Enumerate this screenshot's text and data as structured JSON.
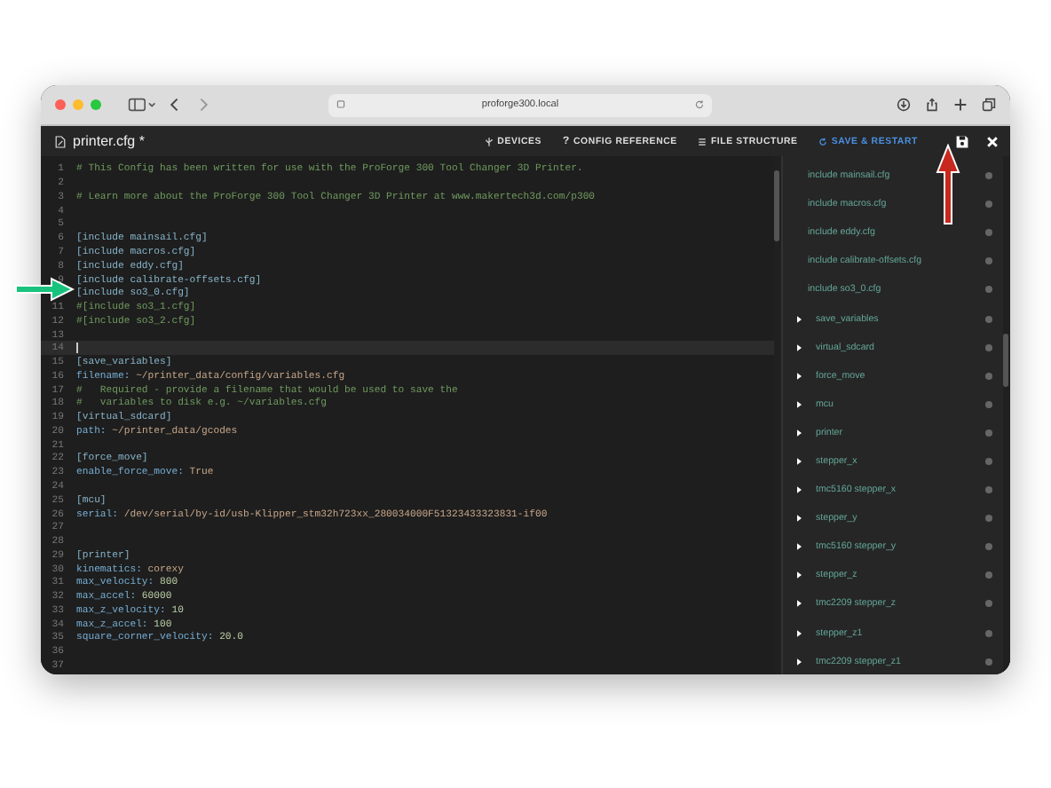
{
  "browser": {
    "url": "proforge300.local"
  },
  "toolbar": {
    "file_title": "printer.cfg *",
    "actions": [
      {
        "kind": "devices",
        "label": "DEVICES"
      },
      {
        "kind": "reference",
        "icon": "?",
        "label": "CONFIG REFERENCE"
      },
      {
        "kind": "structure",
        "label": "FILE STRUCTURE"
      },
      {
        "kind": "save_restart",
        "label": "SAVE & RESTART"
      }
    ]
  },
  "editor": {
    "lines": [
      {
        "n": "1",
        "current": false,
        "parts": [
          {
            "kind": "comment",
            "text": "# This Config has been written for use with the ProForge 300 Tool Changer 3D Printer."
          }
        ]
      },
      {
        "n": "2",
        "current": false
      },
      {
        "n": "3",
        "current": false,
        "parts": [
          {
            "kind": "comment",
            "text": "# Learn more about the ProForge 300 Tool Changer 3D Printer at www.makertech3d.com/p300"
          }
        ]
      },
      {
        "n": "4",
        "current": false
      },
      {
        "n": "5",
        "current": false
      },
      {
        "n": "6",
        "current": false,
        "parts": [
          {
            "kind": "section",
            "text": "[include mainsail.cfg]"
          }
        ]
      },
      {
        "n": "7",
        "current": false,
        "parts": [
          {
            "kind": "section",
            "text": "[include macros.cfg]"
          }
        ]
      },
      {
        "n": "8",
        "current": false,
        "parts": [
          {
            "kind": "section",
            "text": "[include eddy.cfg]"
          }
        ]
      },
      {
        "n": "9",
        "current": false,
        "parts": [
          {
            "kind": "section",
            "text": "[include calibrate-offsets.cfg]"
          }
        ]
      },
      {
        "current": false,
        "parts": [
          {
            "kind": "section",
            "text": "[include so3_0.cfg]"
          }
        ]
      },
      {
        "n": "11",
        "current": false,
        "parts": [
          {
            "kind": "comment",
            "text": "#[include so3_1.cfg]"
          }
        ]
      },
      {
        "n": "12",
        "current": false,
        "parts": [
          {
            "kind": "comment",
            "text": "#[include so3_2.cfg]"
          }
        ]
      },
      {
        "n": "13",
        "current": false
      },
      {
        "n": "14",
        "current": true
      },
      {
        "n": "15",
        "current": false,
        "parts": [
          {
            "kind": "section",
            "text": "[save_variables]"
          }
        ]
      },
      {
        "n": "16",
        "current": false,
        "parts": [
          {
            "kind": "key",
            "text": "filename:"
          },
          {
            "kind": "string",
            "text": " ~/printer_data/config/variables.cfg"
          }
        ]
      },
      {
        "n": "17",
        "current": false,
        "parts": [
          {
            "kind": "comment",
            "text": "#   Required - provide a filename that would be used to save the"
          }
        ]
      },
      {
        "n": "18",
        "current": false,
        "parts": [
          {
            "kind": "comment",
            "text": "#   variables to disk e.g. ~/variables.cfg"
          }
        ]
      },
      {
        "n": "19",
        "current": false,
        "parts": [
          {
            "kind": "section",
            "text": "[virtual_sdcard]"
          }
        ]
      },
      {
        "n": "20",
        "current": false,
        "parts": [
          {
            "kind": "key",
            "text": "path:"
          },
          {
            "kind": "string",
            "text": " ~/printer_data/gcodes"
          }
        ]
      },
      {
        "n": "21",
        "current": false
      },
      {
        "n": "22",
        "current": false,
        "parts": [
          {
            "kind": "section",
            "text": "[force_move]"
          }
        ]
      },
      {
        "n": "23",
        "current": false,
        "parts": [
          {
            "kind": "key",
            "text": "enable_force_move:"
          },
          {
            "kind": "string",
            "text": " True"
          }
        ]
      },
      {
        "n": "24",
        "current": false
      },
      {
        "n": "25",
        "current": false,
        "parts": [
          {
            "kind": "section",
            "text": "[mcu]"
          }
        ]
      },
      {
        "n": "26",
        "current": false,
        "parts": [
          {
            "kind": "key",
            "text": "serial:"
          },
          {
            "kind": "string",
            "text": " /dev/serial/by-id/usb-Klipper_stm32h723xx_280034000F51323433323831-if00"
          }
        ]
      },
      {
        "n": "27",
        "current": false
      },
      {
        "n": "28",
        "current": false
      },
      {
        "n": "29",
        "current": false,
        "parts": [
          {
            "kind": "section",
            "text": "[printer]"
          }
        ]
      },
      {
        "n": "30",
        "current": false,
        "parts": [
          {
            "kind": "key",
            "text": "kinematics:"
          },
          {
            "kind": "string",
            "text": " corexy"
          }
        ]
      },
      {
        "n": "31",
        "current": false,
        "parts": [
          {
            "kind": "key",
            "text": "max_velocity:"
          },
          {
            "kind": "number",
            "text": " 800"
          }
        ]
      },
      {
        "n": "32",
        "current": false,
        "parts": [
          {
            "kind": "key",
            "text": "max_accel:"
          },
          {
            "kind": "number",
            "text": " 60000"
          }
        ]
      },
      {
        "n": "33",
        "current": false,
        "parts": [
          {
            "kind": "key",
            "text": "max_z_velocity:"
          },
          {
            "kind": "number",
            "text": " 10"
          }
        ]
      },
      {
        "n": "34",
        "current": false,
        "parts": [
          {
            "kind": "key",
            "text": "max_z_accel:"
          },
          {
            "kind": "number",
            "text": " 100"
          }
        ]
      },
      {
        "n": "35",
        "current": false,
        "parts": [
          {
            "kind": "key",
            "text": "square_corner_velocity:"
          },
          {
            "kind": "number",
            "text": " 20.0"
          }
        ]
      },
      {
        "n": "36",
        "current": false
      },
      {
        "n": "37",
        "current": false
      }
    ]
  },
  "structure": {
    "items": [
      {
        "kind": "include",
        "label": "include mainsail.cfg"
      },
      {
        "kind": "include",
        "label": "include macros.cfg"
      },
      {
        "kind": "include",
        "label": "include eddy.cfg"
      },
      {
        "kind": "include",
        "label": "include calibrate-offsets.cfg"
      },
      {
        "kind": "include",
        "label": "include so3_0.cfg"
      },
      {
        "kind": "section",
        "label": "save_variables"
      },
      {
        "kind": "section",
        "label": "virtual_sdcard"
      },
      {
        "kind": "section",
        "label": "force_move"
      },
      {
        "kind": "section",
        "label": "mcu"
      },
      {
        "kind": "section",
        "label": "printer"
      },
      {
        "kind": "section",
        "label": "stepper_x"
      },
      {
        "kind": "section",
        "label": "tmc5160 stepper_x"
      },
      {
        "kind": "section",
        "label": "stepper_y"
      },
      {
        "kind": "section",
        "label": "tmc5160 stepper_y"
      },
      {
        "kind": "section",
        "label": "stepper_z"
      },
      {
        "kind": "section",
        "label": "tmc2209 stepper_z"
      },
      {
        "kind": "section",
        "label": "stepper_z1"
      },
      {
        "kind": "section",
        "label": "tmc2209 stepper_z1"
      }
    ]
  }
}
